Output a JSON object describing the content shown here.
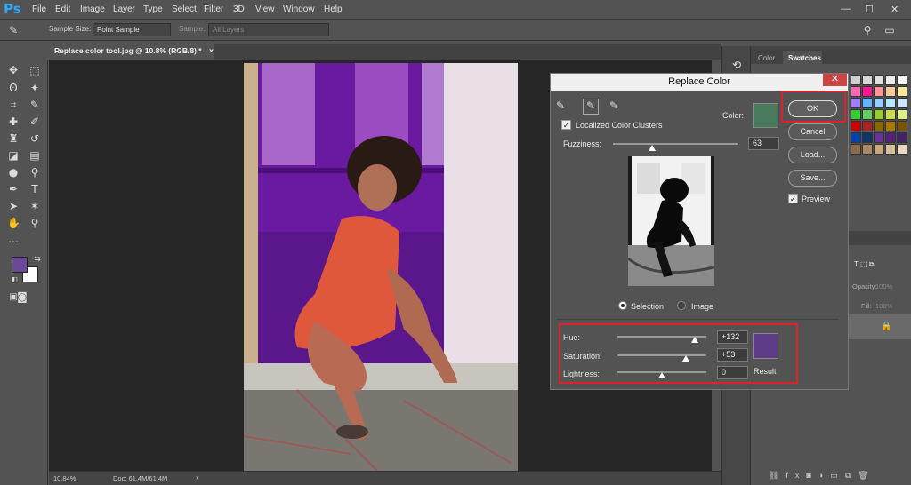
{
  "app": {
    "logo": "Ps"
  },
  "menu": [
    "File",
    "Edit",
    "Image",
    "Layer",
    "Type",
    "Select",
    "Filter",
    "3D",
    "View",
    "Window",
    "Help"
  ],
  "window_controls": [
    "—",
    "☐",
    "✕"
  ],
  "options": {
    "sample_size_label": "Sample Size:",
    "sample_size_value": "Point Sample",
    "sample_label": "Sample:",
    "sample_value": "All Layers"
  },
  "document_tab": {
    "title": "Replace color tool.jpg @ 10.8% (RGB/8) *",
    "close": "×"
  },
  "status": {
    "zoom": "10.84%",
    "doc": "Doc: 61.4M/61.4M"
  },
  "panels": {
    "tab_color": "Color",
    "tab_swatches": "Swatches",
    "opacity_label": "Opacity:",
    "opacity_value": "100%",
    "fill_label": "Fill:",
    "fill_value": "100%"
  },
  "dialog": {
    "title": "Replace Color",
    "close": "✕",
    "localized_label": "Localized Color Clusters",
    "color_label": "Color:",
    "fuzziness_label": "Fuzziness:",
    "fuzziness_value": "63",
    "ok": "OK",
    "cancel": "Cancel",
    "load": "Load...",
    "save": "Save...",
    "preview_label": "Preview",
    "selection_label": "Selection",
    "image_label": "Image",
    "hue_label": "Hue:",
    "hue_value": "+132",
    "saturation_label": "Saturation:",
    "saturation_value": "+53",
    "lightness_label": "Lightness:",
    "lightness_value": "0",
    "result_label": "Result",
    "fuzziness": 63,
    "hue": 132,
    "saturation": 53,
    "lightness": 0,
    "localized_checked": true,
    "preview_checked": true,
    "mode": "Selection"
  },
  "colors": {
    "selected_color": "#4a7a5e",
    "result_color": "#5e3b86",
    "foreground": "#6a4a96",
    "background": "#ffffff",
    "highlight": "#e0202a",
    "ps_blue": "#31a8ff"
  }
}
